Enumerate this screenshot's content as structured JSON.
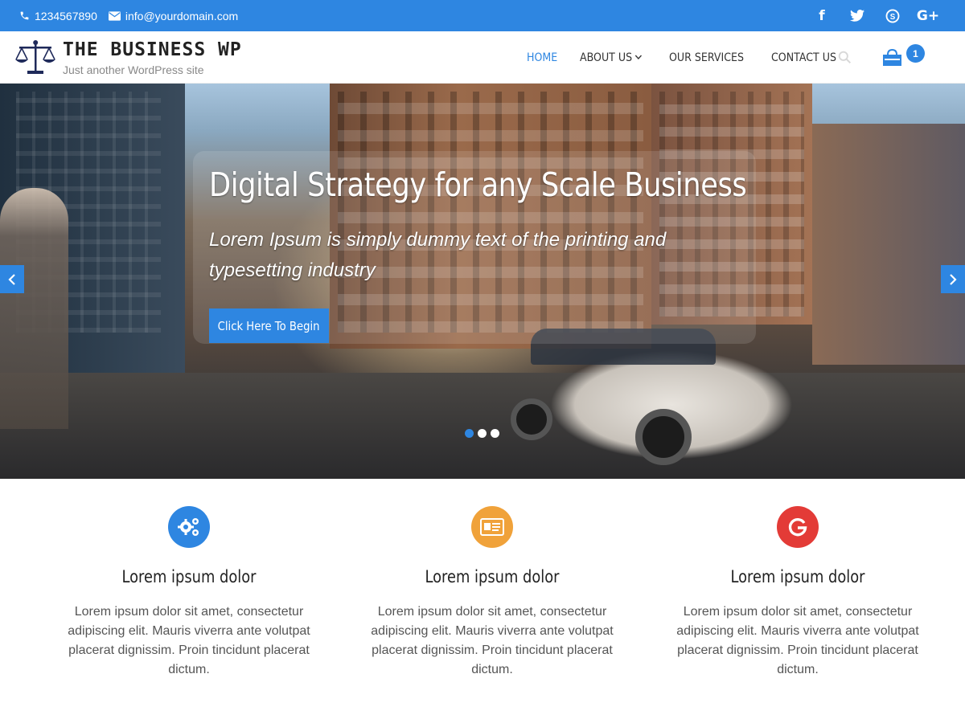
{
  "topbar": {
    "phone": "1234567890",
    "email": "info@yourdomain.com",
    "social": [
      "facebook-icon",
      "twitter-icon",
      "skype-icon",
      "google-plus-icon"
    ],
    "facebook_glyph": "f",
    "google_glyph": "G+"
  },
  "header": {
    "title": "THE BUSINESS WP",
    "tagline": "Just another WordPress site",
    "cart_count": "1"
  },
  "nav": {
    "items": [
      {
        "label": "HOME",
        "active": true
      },
      {
        "label": "ABOUT US",
        "dropdown": true
      },
      {
        "label": "OUR SERVICES"
      },
      {
        "label": "CONTACT US"
      }
    ]
  },
  "hero": {
    "title": "Digital Strategy for any Scale Business",
    "subtitle": "Lorem Ipsum is simply dummy text of the printing and typesetting industry",
    "button": "Click Here To Begin",
    "slides": 3,
    "active_slide": 1
  },
  "features": [
    {
      "icon": "gears-icon",
      "color": "#2e86e1",
      "title": "Lorem ipsum dolor",
      "text": "Lorem ipsum dolor sit amet, consectetur adipiscing elit. Mauris viverra ante volutpat placerat dignissim. Proin tincidunt placerat dictum."
    },
    {
      "icon": "id-card-icon",
      "color": "#f0a23a",
      "title": "Lorem ipsum dolor",
      "text": "Lorem ipsum dolor sit amet, consectetur adipiscing elit. Mauris viverra ante volutpat placerat dignissim. Proin tincidunt placerat dictum."
    },
    {
      "icon": "google-icon",
      "color": "#e33b37",
      "title": "Lorem ipsum dolor",
      "text": "Lorem ipsum dolor sit amet, consectetur adipiscing elit. Mauris viverra ante volutpat placerat dignissim. Proin tincidunt placerat dictum."
    }
  ],
  "colors": {
    "accent": "#2e86e1",
    "orange": "#f0a23a",
    "red": "#e33b37"
  }
}
